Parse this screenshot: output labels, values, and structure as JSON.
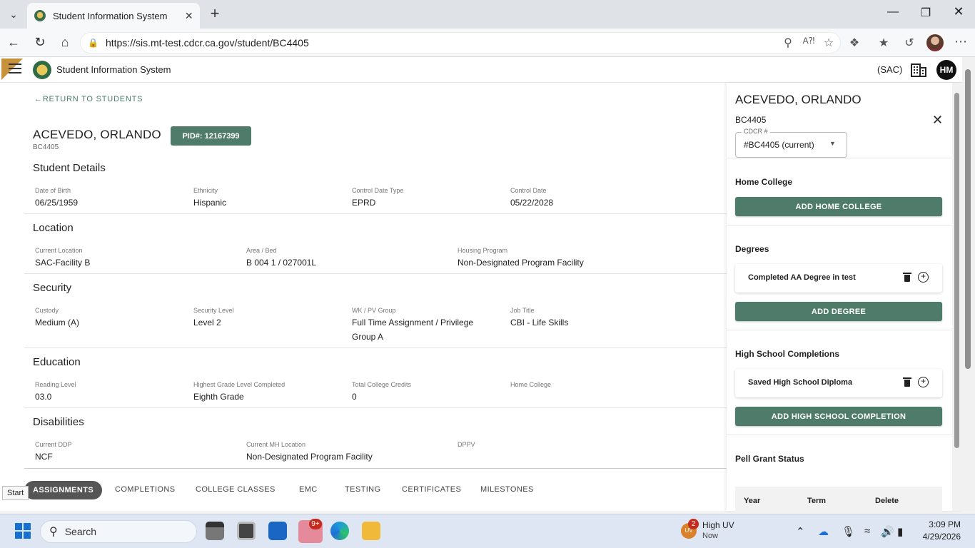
{
  "browser": {
    "tab_title": "Student Information System",
    "url": "https://sis.mt-test.cdcr.ca.gov/student/BC4405"
  },
  "app": {
    "title": "Student Information System",
    "institution": "(SAC)",
    "user_initials": "HM"
  },
  "student": {
    "return_link": "RETURN TO STUDENTS",
    "name": "ACEVEDO, ORLANDO",
    "id": "BC4405",
    "pid": "PID#: 12167399"
  },
  "sections": {
    "details": {
      "title": "Student Details",
      "dob_label": "Date of Birth",
      "dob": "06/25/1959",
      "ethnicity_label": "Ethnicity",
      "ethnicity": "Hispanic",
      "cdt_label": "Control Date Type",
      "cdt": "EPRD",
      "cd_label": "Control Date",
      "cd": "05/22/2028"
    },
    "location": {
      "title": "Location",
      "current_label": "Current Location",
      "current": "SAC-Facility B",
      "area_label": "Area / Bed",
      "area": "B 004 1 / 027001L",
      "housing_label": "Housing Program",
      "housing": "Non-Designated Program Facility"
    },
    "security": {
      "title": "Security",
      "custody_label": "Custody",
      "custody": "Medium (A)",
      "level_label": "Security Level",
      "level": "Level 2",
      "wk_label": "WK / PV Group",
      "wk_line1": "Full Time Assignment / Privilege",
      "wk_line2": "Group A",
      "job_label": "Job Title",
      "job": "CBI - Life Skills"
    },
    "education": {
      "title": "Education",
      "reading_label": "Reading Level",
      "reading": "03.0",
      "grade_label": "Highest Grade Level Completed",
      "grade": "Eighth Grade",
      "credits_label": "Total College Credits",
      "credits": "0",
      "home_label": "Home College"
    },
    "disabilities": {
      "title": "Disabilities",
      "ddp_label": "Current DDP",
      "ddp": "NCF",
      "mh_label": "Current MH Location",
      "mh": "Non-Designated Program Facility",
      "dppv_label": "DPPV"
    }
  },
  "tabs": [
    "ASSIGNMENTS",
    "COMPLETIONS",
    "COLLEGE CLASSES",
    "EMC",
    "TESTING",
    "CERTIFICATES",
    "MILESTONES"
  ],
  "start_tooltip": "Start",
  "panel": {
    "name": "ACEVEDO, ORLANDO",
    "id": "BC4405",
    "cdcr_label": "CDCR #",
    "cdcr_value": "#BC4405 (current)",
    "home_college_title": "Home College",
    "add_home_college": "ADD HOME COLLEGE",
    "degrees_title": "Degrees",
    "degree_item": "Completed AA Degree in test",
    "add_degree": "ADD DEGREE",
    "hs_title": "High School Completions",
    "hs_item": "Saved High School Diploma",
    "add_hs": "ADD HIGH SCHOOL COMPLETION",
    "pell_title": "Pell Grant Status",
    "pell_cols": [
      "Year",
      "Term",
      "Delete"
    ]
  },
  "taskbar": {
    "search_placeholder": "Search",
    "teams_badge": "9+",
    "weather_badge": "2",
    "weather_icon_text": "UV",
    "weather_title": "High UV",
    "weather_sub": "Now",
    "time": "3:09 PM",
    "date": "4/29/2026"
  },
  "colors": {
    "accent": "#4f7b6b",
    "link": "#4a7c6a"
  }
}
